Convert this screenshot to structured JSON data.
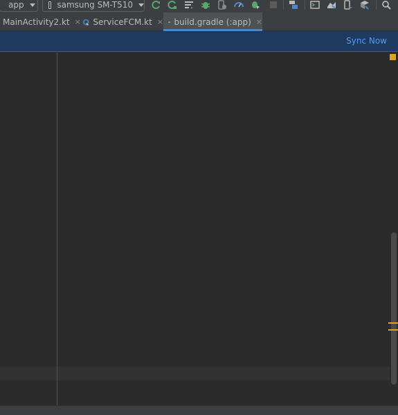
{
  "toolbar": {
    "run_config": "app",
    "device": "samsung SM-T510",
    "icons": [
      "apply-changes-restart-icon",
      "apply-code-changes-icon",
      "logcat-icon",
      "debug-icon",
      "attach-debugger-icon",
      "profile-icon",
      "run-coverage-icon",
      "stop-icon",
      "project-structure-icon",
      "terminal-icon",
      "sdk-manager-icon",
      "avd-manager-icon",
      "layout-inspector-icon",
      "search-icon"
    ]
  },
  "tabs": [
    {
      "label": "MainActivity2.kt",
      "active": false
    },
    {
      "label": "ServiceFCM.kt",
      "active": false
    },
    {
      "label": "build.gradle (:app)",
      "active": true
    }
  ],
  "tab_close": "×",
  "banner": {
    "sync_label": "Sync Now"
  },
  "colors": {
    "accent": "#4a88c7",
    "link": "#589df6",
    "banner_bg": "#1e3a5e",
    "warning": "#e0a31a"
  }
}
